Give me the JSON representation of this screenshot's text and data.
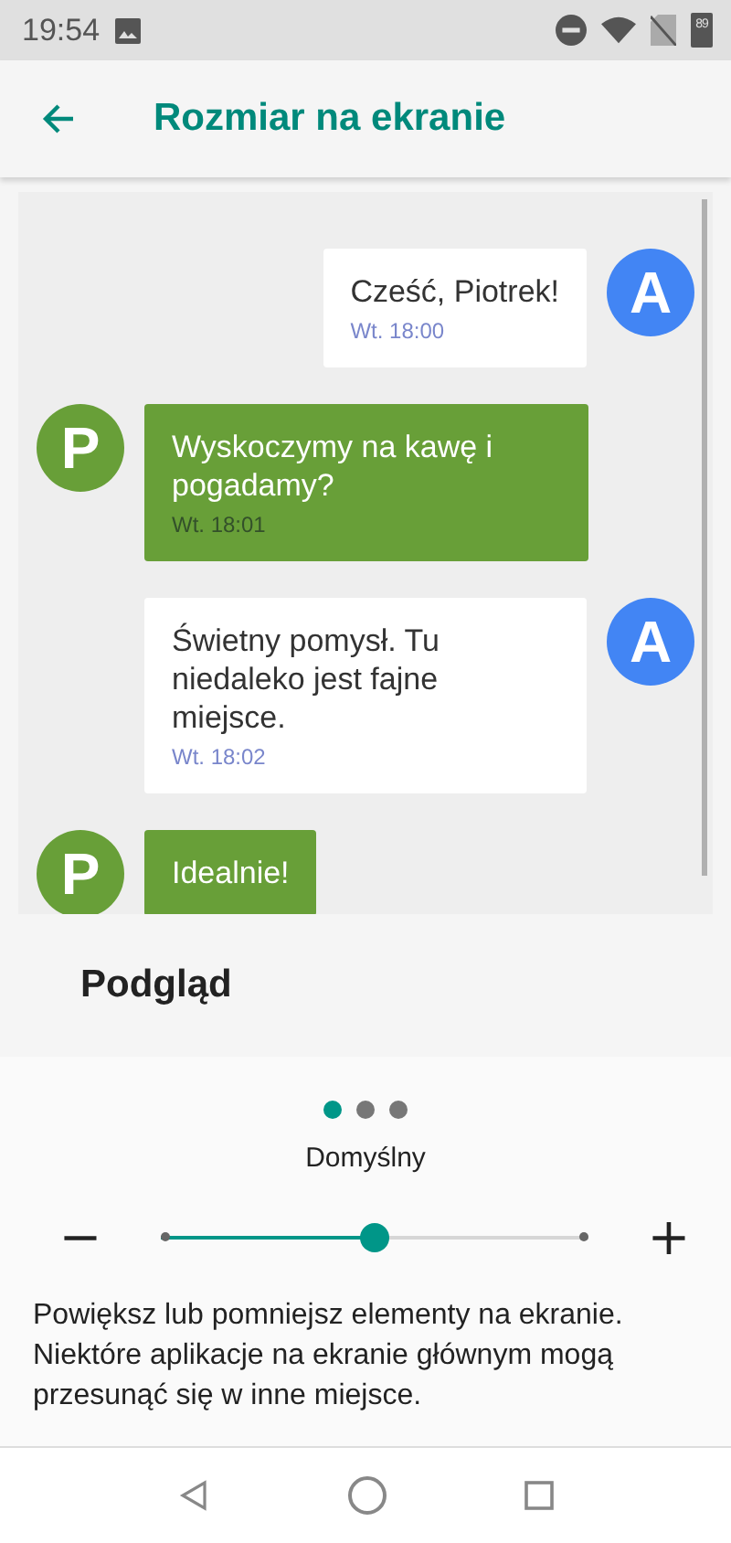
{
  "status_bar": {
    "time": "19:54",
    "battery": "89"
  },
  "app_bar": {
    "title": "Rozmiar na ekranie"
  },
  "preview": {
    "messages": [
      {
        "kind": "sent",
        "avatar": "A",
        "text": "Cześć, Piotrek!",
        "time": "Wt. 18:00"
      },
      {
        "kind": "received",
        "avatar": "P",
        "text": "Wyskoczymy na kawę i pogadamy?",
        "time": "Wt. 18:01"
      },
      {
        "kind": "sent",
        "avatar": "A",
        "text": "Świetny pomysł. Tu niedaleko jest fajne miejsce.",
        "time": "Wt. 18:02"
      },
      {
        "kind": "received",
        "avatar": "P",
        "text": "Idealnie!"
      }
    ],
    "label": "Podgląd"
  },
  "pager": [
    {
      "selected": true
    },
    {
      "selected": false
    },
    {
      "selected": false
    }
  ],
  "size_label": "Domyślny",
  "slider": {
    "minus": "−",
    "plus": "+",
    "level": 0.5
  },
  "description": "Powiększ lub pomniejsz elementy na ekranie. Niektóre aplikacje na ekranie głównym mogą przesunąć się w inne miejsce."
}
